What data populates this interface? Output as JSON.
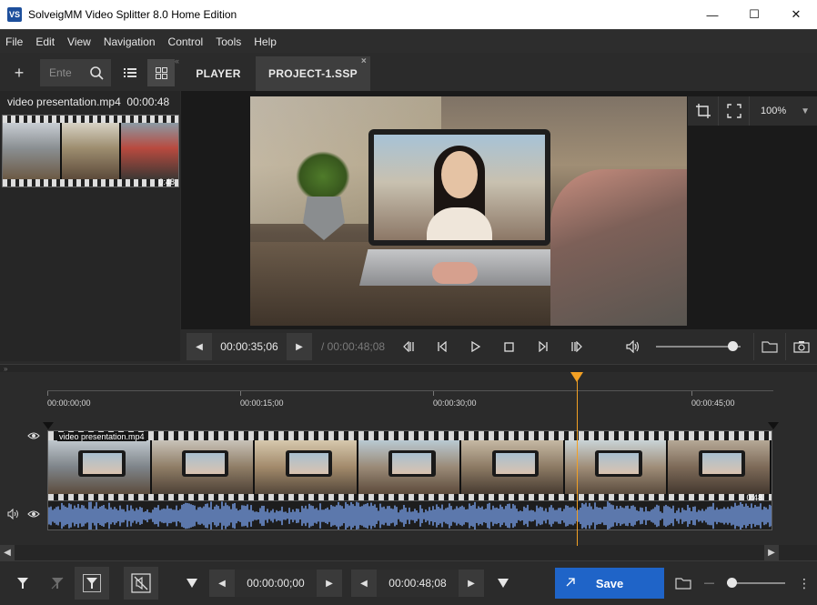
{
  "window": {
    "app_icon_text": "VS",
    "title": "SolveigMM Video Splitter 8.0 Home Edition",
    "minimize": "—",
    "maximize": "☐",
    "close": "✕"
  },
  "menu": [
    "File",
    "Edit",
    "View",
    "Navigation",
    "Control",
    "Tools",
    "Help"
  ],
  "library": {
    "add_label": "+",
    "search_placeholder": "Ente",
    "collapse_mark": "«",
    "file": {
      "name": "video presentation.mp4",
      "duration": "00:00:48",
      "thumb_duration": "0:48"
    }
  },
  "tabs": [
    {
      "label": "PLAYER",
      "active": false
    },
    {
      "label": "PROJECT-1.SSP",
      "active": true,
      "close": "×"
    }
  ],
  "viewer": {
    "zoom": "100%",
    "zoom_arrow": "▼"
  },
  "transport": {
    "prev": "◀",
    "next": "▶",
    "current_time": "00:00:35;06",
    "total_time": "/ 00:00:48;08",
    "volume": 0.88
  },
  "splitter_mark": "»",
  "timeline": {
    "ruler_labels": [
      "00:00:00;00",
      "00:00:15;00",
      "00:00:30;00",
      "00:00:45;00"
    ],
    "playhead_time_fraction": 0.7306,
    "track_label": "video presentation.mp4",
    "track_duration": "0:48",
    "scroll_left": "◀",
    "scroll_right": "▶"
  },
  "bottom": {
    "start_time": "00:00:00;00",
    "end_time": "00:00:48;08",
    "prev": "◀",
    "next": "▶",
    "save_label": "Save",
    "zoom_minus": "—",
    "more": "⋮",
    "zoom": 0
  },
  "colors": {
    "accent": "#1f64c8",
    "playhead": "#f2a024",
    "waveform": "#6d8fd1"
  }
}
